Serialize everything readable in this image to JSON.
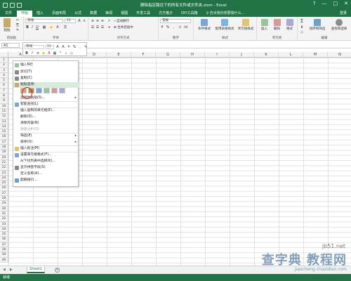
{
  "window": {
    "title": "删除指定路径下的所有文件或文件夹.xlsm - Excel",
    "controls": [
      "?",
      "—",
      "□",
      "✕"
    ]
  },
  "tabs": [
    "文件",
    "开始",
    "插入",
    "页面布局",
    "公式",
    "数据",
    "审阅",
    "视图",
    "开发工具",
    "方方格子",
    "DIY工具箱"
  ],
  "active_tab": "开始",
  "tell_me": "♀ 告诉我你想要做什么...",
  "login": "登录",
  "ribbon": {
    "paste": "粘贴",
    "clipboard_label": "剪贴板",
    "font_name": "等线",
    "font_size": "11",
    "font_label": "字体",
    "wrap_text": "自动换行",
    "merge_center": "合并后居中",
    "align_label": "对齐方式",
    "number_format": "常规",
    "number_label": "数字",
    "conditional_format": "条件格式",
    "format_table": "套用表格格式",
    "cell_styles": "单元格样式",
    "styles_label": "样式",
    "insert": "插入",
    "delete": "删除",
    "format": "格式",
    "cells_label": "单元格",
    "sum": "Σ",
    "sort_filter": "排序和筛选",
    "find_select": "查找和选择",
    "editing_label": "编辑"
  },
  "formula_bar": {
    "name_box": "A1",
    "value": ""
  },
  "mini_toolbar": {
    "font_name": "等线",
    "font_size": "11",
    "bold": "B",
    "italic": "I"
  },
  "columns": [
    "A",
    "B",
    "C",
    "D",
    "E",
    "F",
    "G",
    "H",
    "I",
    "J",
    "K",
    "L",
    "M",
    "N"
  ],
  "rows": [
    "1",
    "2",
    "3",
    "4",
    "5",
    "6",
    "7",
    "8",
    "9",
    "10",
    "11",
    "12",
    "13",
    "14",
    "15",
    "16",
    "17",
    "18",
    "19",
    "20",
    "21",
    "22",
    "23",
    "24",
    "25",
    "26",
    "27",
    "28",
    "29",
    "30",
    "31",
    "32",
    "33",
    "34",
    "35",
    "36",
    "37",
    "38",
    "39",
    "40"
  ],
  "context_menu": {
    "items": [
      {
        "label": "插入N行",
        "state": "normal"
      },
      {
        "label": "剪切(T)",
        "state": "normal"
      },
      {
        "label": "复制(C)",
        "state": "normal"
      },
      {
        "label": "粘贴选项:",
        "state": "highlight"
      },
      {
        "label": "选择性粘贴(S)...",
        "state": "normal"
      },
      {
        "label": "智能查找(L)",
        "state": "normal"
      },
      {
        "label": "插入复制的单元格(E)...",
        "state": "normal"
      },
      {
        "label": "删除(D)...",
        "state": "normal"
      },
      {
        "label": "清除内容(N)",
        "state": "normal"
      },
      {
        "label": "快速分析(Q)",
        "state": "disabled"
      },
      {
        "label": "筛选(E)",
        "state": "normal"
      },
      {
        "label": "排序(O)",
        "state": "normal"
      },
      {
        "label": "插入批注(M)",
        "state": "normal"
      },
      {
        "label": "设置单元格格式(F)...",
        "state": "normal"
      },
      {
        "label": "从下拉列表中选择(K)...",
        "state": "normal"
      },
      {
        "label": "显示拼音字段(S)",
        "state": "normal"
      },
      {
        "label": "定义名称(A)...",
        "state": "normal"
      },
      {
        "label": "超链接(I)...",
        "state": "normal"
      }
    ],
    "paste_options": [
      "粘贴",
      "值",
      "公式",
      "转置",
      "格式",
      "链接"
    ]
  },
  "sheets": [
    "Sheet1"
  ],
  "add_sheet": "+",
  "status": "就绪",
  "watermark": {
    "site": "jb51.net",
    "text": "查字典 教程网",
    "url": "jiaocheng.chazidian.com"
  },
  "colors": {
    "excel_green": "#217346",
    "highlight": "#d7ebdd",
    "annotation_red": "#e0231d"
  }
}
